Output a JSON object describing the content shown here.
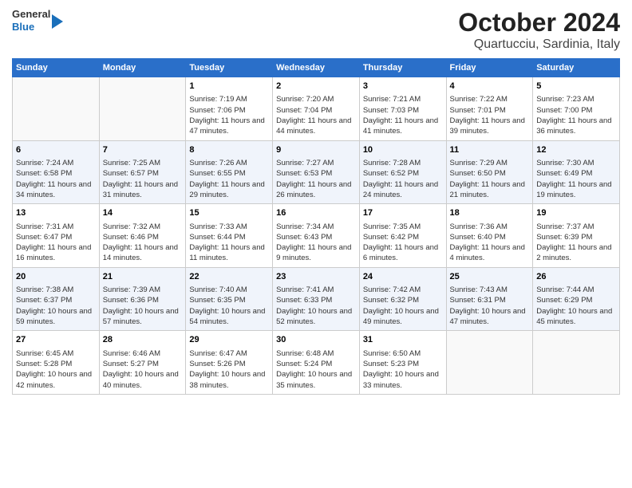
{
  "header": {
    "logo_line1": "General",
    "logo_line2": "Blue",
    "title": "October 2024",
    "subtitle": "Quartucciu, Sardinia, Italy"
  },
  "days_of_week": [
    "Sunday",
    "Monday",
    "Tuesday",
    "Wednesday",
    "Thursday",
    "Friday",
    "Saturday"
  ],
  "weeks": [
    [
      {
        "num": "",
        "sunrise": "",
        "sunset": "",
        "daylight": ""
      },
      {
        "num": "",
        "sunrise": "",
        "sunset": "",
        "daylight": ""
      },
      {
        "num": "1",
        "sunrise": "Sunrise: 7:19 AM",
        "sunset": "Sunset: 7:06 PM",
        "daylight": "Daylight: 11 hours and 47 minutes."
      },
      {
        "num": "2",
        "sunrise": "Sunrise: 7:20 AM",
        "sunset": "Sunset: 7:04 PM",
        "daylight": "Daylight: 11 hours and 44 minutes."
      },
      {
        "num": "3",
        "sunrise": "Sunrise: 7:21 AM",
        "sunset": "Sunset: 7:03 PM",
        "daylight": "Daylight: 11 hours and 41 minutes."
      },
      {
        "num": "4",
        "sunrise": "Sunrise: 7:22 AM",
        "sunset": "Sunset: 7:01 PM",
        "daylight": "Daylight: 11 hours and 39 minutes."
      },
      {
        "num": "5",
        "sunrise": "Sunrise: 7:23 AM",
        "sunset": "Sunset: 7:00 PM",
        "daylight": "Daylight: 11 hours and 36 minutes."
      }
    ],
    [
      {
        "num": "6",
        "sunrise": "Sunrise: 7:24 AM",
        "sunset": "Sunset: 6:58 PM",
        "daylight": "Daylight: 11 hours and 34 minutes."
      },
      {
        "num": "7",
        "sunrise": "Sunrise: 7:25 AM",
        "sunset": "Sunset: 6:57 PM",
        "daylight": "Daylight: 11 hours and 31 minutes."
      },
      {
        "num": "8",
        "sunrise": "Sunrise: 7:26 AM",
        "sunset": "Sunset: 6:55 PM",
        "daylight": "Daylight: 11 hours and 29 minutes."
      },
      {
        "num": "9",
        "sunrise": "Sunrise: 7:27 AM",
        "sunset": "Sunset: 6:53 PM",
        "daylight": "Daylight: 11 hours and 26 minutes."
      },
      {
        "num": "10",
        "sunrise": "Sunrise: 7:28 AM",
        "sunset": "Sunset: 6:52 PM",
        "daylight": "Daylight: 11 hours and 24 minutes."
      },
      {
        "num": "11",
        "sunrise": "Sunrise: 7:29 AM",
        "sunset": "Sunset: 6:50 PM",
        "daylight": "Daylight: 11 hours and 21 minutes."
      },
      {
        "num": "12",
        "sunrise": "Sunrise: 7:30 AM",
        "sunset": "Sunset: 6:49 PM",
        "daylight": "Daylight: 11 hours and 19 minutes."
      }
    ],
    [
      {
        "num": "13",
        "sunrise": "Sunrise: 7:31 AM",
        "sunset": "Sunset: 6:47 PM",
        "daylight": "Daylight: 11 hours and 16 minutes."
      },
      {
        "num": "14",
        "sunrise": "Sunrise: 7:32 AM",
        "sunset": "Sunset: 6:46 PM",
        "daylight": "Daylight: 11 hours and 14 minutes."
      },
      {
        "num": "15",
        "sunrise": "Sunrise: 7:33 AM",
        "sunset": "Sunset: 6:44 PM",
        "daylight": "Daylight: 11 hours and 11 minutes."
      },
      {
        "num": "16",
        "sunrise": "Sunrise: 7:34 AM",
        "sunset": "Sunset: 6:43 PM",
        "daylight": "Daylight: 11 hours and 9 minutes."
      },
      {
        "num": "17",
        "sunrise": "Sunrise: 7:35 AM",
        "sunset": "Sunset: 6:42 PM",
        "daylight": "Daylight: 11 hours and 6 minutes."
      },
      {
        "num": "18",
        "sunrise": "Sunrise: 7:36 AM",
        "sunset": "Sunset: 6:40 PM",
        "daylight": "Daylight: 11 hours and 4 minutes."
      },
      {
        "num": "19",
        "sunrise": "Sunrise: 7:37 AM",
        "sunset": "Sunset: 6:39 PM",
        "daylight": "Daylight: 11 hours and 2 minutes."
      }
    ],
    [
      {
        "num": "20",
        "sunrise": "Sunrise: 7:38 AM",
        "sunset": "Sunset: 6:37 PM",
        "daylight": "Daylight: 10 hours and 59 minutes."
      },
      {
        "num": "21",
        "sunrise": "Sunrise: 7:39 AM",
        "sunset": "Sunset: 6:36 PM",
        "daylight": "Daylight: 10 hours and 57 minutes."
      },
      {
        "num": "22",
        "sunrise": "Sunrise: 7:40 AM",
        "sunset": "Sunset: 6:35 PM",
        "daylight": "Daylight: 10 hours and 54 minutes."
      },
      {
        "num": "23",
        "sunrise": "Sunrise: 7:41 AM",
        "sunset": "Sunset: 6:33 PM",
        "daylight": "Daylight: 10 hours and 52 minutes."
      },
      {
        "num": "24",
        "sunrise": "Sunrise: 7:42 AM",
        "sunset": "Sunset: 6:32 PM",
        "daylight": "Daylight: 10 hours and 49 minutes."
      },
      {
        "num": "25",
        "sunrise": "Sunrise: 7:43 AM",
        "sunset": "Sunset: 6:31 PM",
        "daylight": "Daylight: 10 hours and 47 minutes."
      },
      {
        "num": "26",
        "sunrise": "Sunrise: 7:44 AM",
        "sunset": "Sunset: 6:29 PM",
        "daylight": "Daylight: 10 hours and 45 minutes."
      }
    ],
    [
      {
        "num": "27",
        "sunrise": "Sunrise: 6:45 AM",
        "sunset": "Sunset: 5:28 PM",
        "daylight": "Daylight: 10 hours and 42 minutes."
      },
      {
        "num": "28",
        "sunrise": "Sunrise: 6:46 AM",
        "sunset": "Sunset: 5:27 PM",
        "daylight": "Daylight: 10 hours and 40 minutes."
      },
      {
        "num": "29",
        "sunrise": "Sunrise: 6:47 AM",
        "sunset": "Sunset: 5:26 PM",
        "daylight": "Daylight: 10 hours and 38 minutes."
      },
      {
        "num": "30",
        "sunrise": "Sunrise: 6:48 AM",
        "sunset": "Sunset: 5:24 PM",
        "daylight": "Daylight: 10 hours and 35 minutes."
      },
      {
        "num": "31",
        "sunrise": "Sunrise: 6:50 AM",
        "sunset": "Sunset: 5:23 PM",
        "daylight": "Daylight: 10 hours and 33 minutes."
      },
      {
        "num": "",
        "sunrise": "",
        "sunset": "",
        "daylight": ""
      },
      {
        "num": "",
        "sunrise": "",
        "sunset": "",
        "daylight": ""
      }
    ]
  ]
}
